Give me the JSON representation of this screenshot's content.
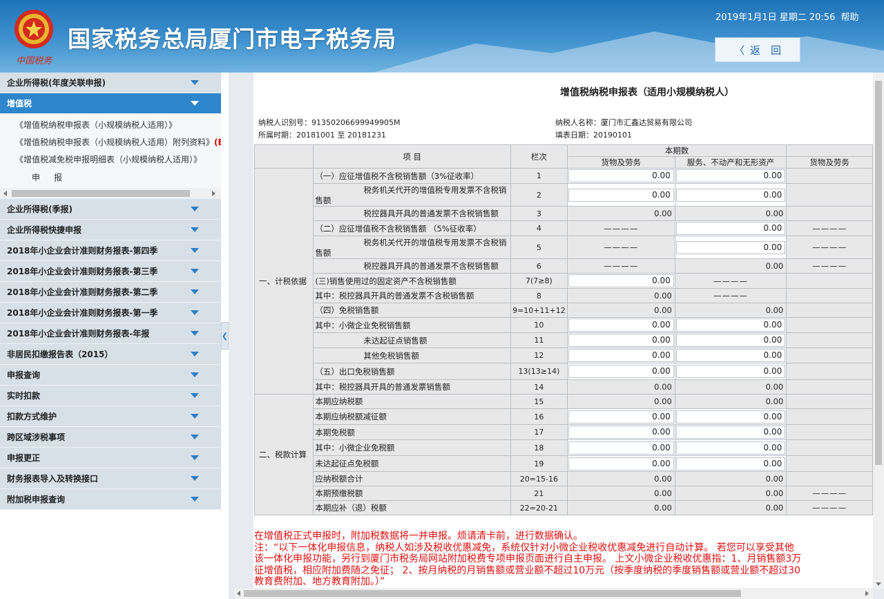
{
  "header": {
    "site_title": "国家税务总局厦门市电子税务局",
    "datetime": "2019年1月1日 星期二 20:56",
    "help": "帮助",
    "back_label": "返　回",
    "logo_text": "中国税务"
  },
  "sidebar": {
    "items": [
      {
        "label": "企业所得税(年度关联申报)"
      },
      {
        "label": "增值税"
      },
      {
        "label": "企业所得税(季报)"
      },
      {
        "label": "企业所得税快捷申报"
      },
      {
        "label": "2018年小企业会计准则财务报表-第四季"
      },
      {
        "label": "2018年小企业会计准则财务报表-第三季"
      },
      {
        "label": "2018年小企业会计准则财务报表-第二季"
      },
      {
        "label": "2018年小企业会计准则财务报表-第一季"
      },
      {
        "label": "2018年小企业会计准则财务报表-年报"
      },
      {
        "label": "非居民扣缴报告表（2015）"
      },
      {
        "label": "申报查询"
      },
      {
        "label": "实时扣款"
      },
      {
        "label": "扣款方式维护"
      },
      {
        "label": "跨区域涉税事项"
      },
      {
        "label": "申报更正"
      },
      {
        "label": "财务报表导入及转换接口"
      },
      {
        "label": "附加税申报查询"
      }
    ],
    "sub_items": [
      {
        "label": "《增值税纳税申报表（小规模纳税人适用）》"
      },
      {
        "label": "《增值税纳税申报表（小规模纳税人适用）附列资料》",
        "flag": "(E"
      },
      {
        "label": "《增值税减免税申报明细表（小规模纳税人适用）》"
      }
    ],
    "submit": "申报"
  },
  "form": {
    "title": "增值税纳税申报表（适用小规模纳税人）",
    "taxpayer_id_label": "纳税人识别号：",
    "taxpayer_id": "91350206699949905M",
    "taxpayer_name_label": "纳税人名称：",
    "taxpayer_name": "厦门市汇鑫达贸易有限公司",
    "period_label": "所属时期：",
    "period": "20181001 至 20181231",
    "fill_date_label": "填表日期：",
    "fill_date": "20190101",
    "col_item": "项 目",
    "col_line": "栏次",
    "col_current": "本期数",
    "col_goods": "货物及劳务",
    "col_services": "服务、不动产和无形资产",
    "col_goods2": "货物及劳务",
    "section1": "一、计税依据",
    "section2": "二、税款计算",
    "dash": "————",
    "rows": [
      {
        "item": "（一）应征增值税不含税销售额（3%征收率）",
        "line": "1",
        "goods": "0.00",
        "services": "0.00"
      },
      {
        "item": "税务机关代开的增值税专用发票不含税销售额",
        "line": "2",
        "goods": "0.00",
        "services": "0.00"
      },
      {
        "item": "税控器具开具的普通发票不含税销售额",
        "line": "3",
        "goods": "0.00",
        "services": "0.00"
      },
      {
        "item": "（二）应征增值税不含税销售额 （5%征收率）",
        "line": "4",
        "services": "0.00"
      },
      {
        "item": "税务机关代开的增值税专用发票不含税销售额",
        "line": "5",
        "services": "0.00"
      },
      {
        "item": "税控器具开具的普通发票不含税销售额",
        "line": "6",
        "services": "0.00"
      },
      {
        "item": "(三)销售使用过的固定资产不含税销售额",
        "line": "7(7≥8)",
        "goods": "0.00"
      },
      {
        "item": "其中：税控器具开具的普通发票不含税销售额",
        "line": "8",
        "goods": "0.00"
      },
      {
        "item": "（四）免税销售额",
        "line": "9=10+11+12",
        "goods": "0.00",
        "services": "0.00"
      },
      {
        "item": "其中：小微企业免税销售额",
        "line": "10",
        "goods": "0.00",
        "services": "0.00"
      },
      {
        "item": "未达起征点销售额",
        "line": "11",
        "goods": "0.00",
        "services": "0.00"
      },
      {
        "item": "其他免税销售额",
        "line": "12",
        "goods": "0.00",
        "services": "0.00"
      },
      {
        "item": "（五）出口免税销售额",
        "line": "13(13≥14)",
        "goods": "0.00",
        "services": "0.00"
      },
      {
        "item": "其中：税控器具开具的普通发票销售额",
        "line": "14",
        "goods": "0.00",
        "services": "0.00"
      },
      {
        "item": "本期应纳税额",
        "line": "15",
        "goods": "0.00",
        "services": "0.00"
      },
      {
        "item": "本期应纳税额减征额",
        "line": "16",
        "goods": "0.00",
        "services": "0.00"
      },
      {
        "item": "本期免税额",
        "line": "17",
        "goods": "0.00",
        "services": "0.00"
      },
      {
        "item": "其中：小微企业免税额",
        "line": "18",
        "goods": "0.00",
        "services": "0.00"
      },
      {
        "item": "未达起征点免税额",
        "line": "19",
        "goods": "0.00",
        "services": "0.00"
      },
      {
        "item": "应纳税额合计",
        "line": "20=15-16",
        "goods": "0.00",
        "services": "0.00"
      },
      {
        "item": "本期预缴税额",
        "line": "21",
        "goods": "0.00",
        "services": "0.00"
      },
      {
        "item": "本期应补（退）税额",
        "line": "22=20-21",
        "goods": "0.00",
        "services": "0.00"
      }
    ],
    "notes": [
      "在增值税正式申报时，附加税数据将一并申报。烦请清卡前，进行数据确认。",
      "注：“以下一体化申报信息，纳税人如涉及税收优惠减免，系统仅针对小微企业税收优惠减免进行自动计算。 若您可以享受其他",
      "该一体化申报功能，另行到厦门市税务局网站附加税费专项申报页面进行自主申报。 上文小微企业税收优惠指：1、月销售额3万",
      "征增值税，相应附加费随之免征； 2、按月纳税的月销售额或营业额不超过10万元（按季度纳税的季度销售额或营业额不超过30",
      "教育费附加、地方教育附加。）”"
    ]
  }
}
